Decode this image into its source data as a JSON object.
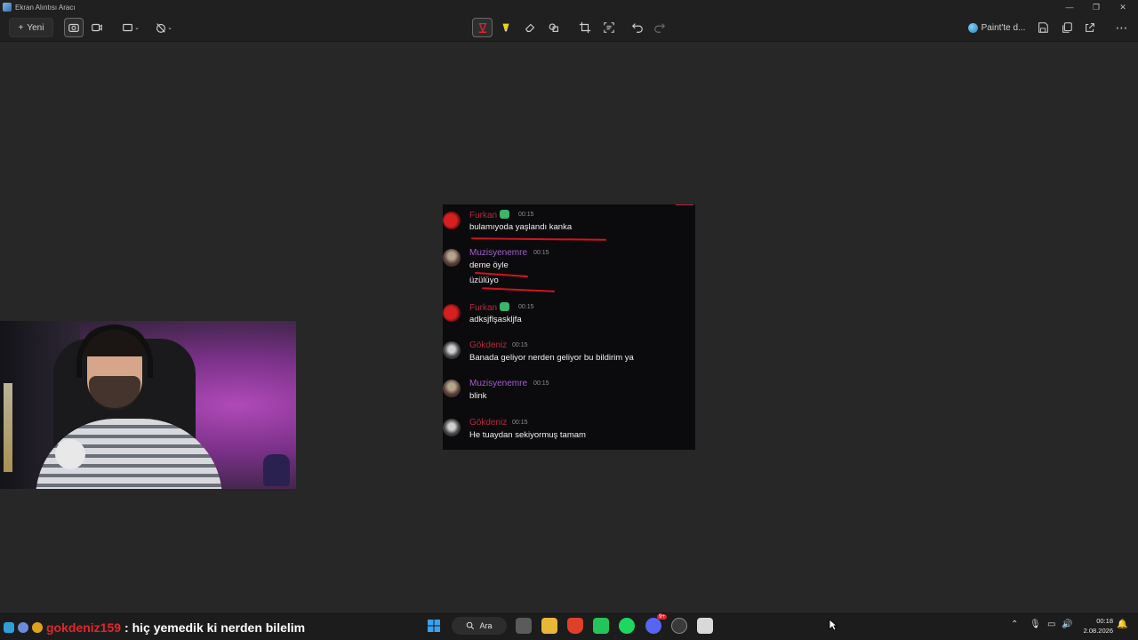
{
  "window": {
    "title": "Ekran Alıntısı Aracı"
  },
  "toolbar": {
    "new_label": "Yeni",
    "paint_label": "Paint'te d...",
    "active_tool": "pen",
    "accent_color": "#e0262e"
  },
  "chat": {
    "messages": [
      {
        "user": "Furkan",
        "user_color": "#b4283b",
        "badge": true,
        "time": "00:15",
        "lines": [
          "bulamıyoda yaşlandı kanka"
        ],
        "avatar": "red"
      },
      {
        "user": "Muzisyenemre",
        "user_color": "#a45ecf",
        "badge": false,
        "time": "00:15",
        "lines": [
          "deme öyle",
          "üzülüyo"
        ],
        "avatar": "mix"
      },
      {
        "user": "Furkan",
        "user_color": "#b4283b",
        "badge": true,
        "time": "00:15",
        "lines": [
          "adksjflşaskljfa"
        ],
        "avatar": "red"
      },
      {
        "user": "Gökdeniz",
        "user_color": "#b4283b",
        "badge": false,
        "time": "00:15",
        "lines": [
          "Banada geliyor nerden geliyor bu bildirim ya"
        ],
        "avatar": "gray"
      },
      {
        "user": "Muzisyenemre",
        "user_color": "#a45ecf",
        "badge": false,
        "time": "00:15",
        "lines": [
          "blink"
        ],
        "avatar": "mix"
      },
      {
        "user": "Gökdeniz",
        "user_color": "#b4283b",
        "badge": false,
        "time": "00:15",
        "lines": [
          "He tuaydan sekiyormuş tamam"
        ],
        "avatar": "gray"
      }
    ]
  },
  "stream_overlay": {
    "username": "gokdeniz159",
    "message": ": hiç yemedik ki nerden bilelim"
  },
  "taskbar": {
    "search_label": "Ara",
    "clock_time": "00:18",
    "clock_date": "2.08.2026",
    "discord_badge": "9+"
  }
}
